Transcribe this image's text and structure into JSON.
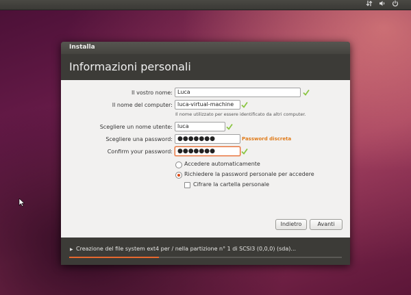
{
  "window": {
    "title": "Installa"
  },
  "page": {
    "title": "Informazioni personali"
  },
  "form": {
    "name_label": "Il vostro nome:",
    "name_value": "Luca",
    "computer_label": "Il nome del computer:",
    "computer_value": "luca-virtual-machine",
    "computer_hint": "Il nome utilizzato per essere identificato da altri computer.",
    "username_label": "Scegliere un nome utente:",
    "username_value": "luca",
    "password_label": "Scegliere una password:",
    "password_value": "●●●●●●●",
    "password_strength": "Password discreta",
    "confirm_label": "Confirm your password:",
    "confirm_value": "●●●●●●●"
  },
  "options": {
    "auto_login": {
      "label": "Accedere automaticamente",
      "selected": false
    },
    "require_password": {
      "label": "Richiedere la password personale per accedere",
      "selected": true
    },
    "encrypt_home": {
      "label": "Cifrare la cartella personale",
      "checked": false
    }
  },
  "buttons": {
    "back": "Indietro",
    "forward": "Avanti"
  },
  "status": {
    "text": "Creazione del file system ext4 per / nella partizione n° 1 di SCSI3 (0,0,0) (sda)...",
    "progress": 0.33
  },
  "icons": {
    "tray": [
      "network-icon",
      "volume-icon",
      "power-icon"
    ],
    "valid": "checkmark-icon"
  },
  "colors": {
    "accent": "#e8692e",
    "check": "#8ac541",
    "strength": "#e07b1a"
  }
}
